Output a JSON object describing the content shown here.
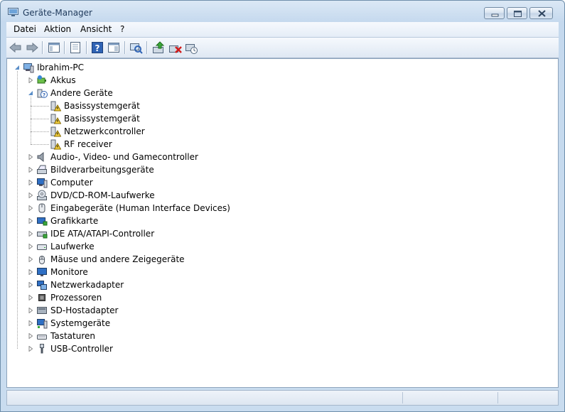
{
  "window": {
    "title": "Geräte-Manager"
  },
  "menu": [
    "Datei",
    "Aktion",
    "Ansicht",
    "?"
  ],
  "toolbar": [
    "back-arrow-icon",
    "forward-arrow-icon",
    "show-hide-console-tree-icon",
    "properties-icon",
    "help-icon",
    "console-tree-toggle-icon",
    "scan-hardware-icon",
    "update-driver-icon",
    "uninstall-device-icon",
    "disable-device-icon"
  ],
  "tree": {
    "root": "Ibrahim-PC",
    "categories": [
      {
        "label": "Akkus",
        "icon": "battery-icon",
        "expanded": false
      },
      {
        "label": "Andere Geräte",
        "icon": "unknown-device-icon",
        "expanded": true,
        "children": [
          {
            "label": "Basissystemgerät",
            "icon": "warning-device-icon"
          },
          {
            "label": "Basissystemgerät",
            "icon": "warning-device-icon"
          },
          {
            "label": "Netzwerkcontroller",
            "icon": "warning-device-icon"
          },
          {
            "label": "RF receiver",
            "icon": "warning-device-icon"
          }
        ]
      },
      {
        "label": "Audio-, Video- und Gamecontroller",
        "icon": "speaker-icon",
        "expanded": false
      },
      {
        "label": "Bildverarbeitungsgeräte",
        "icon": "scanner-icon",
        "expanded": false
      },
      {
        "label": "Computer",
        "icon": "computer-icon",
        "expanded": false
      },
      {
        "label": "DVD/CD-ROM-Laufwerke",
        "icon": "optical-drive-icon",
        "expanded": false
      },
      {
        "label": "Eingabegeräte (Human Interface Devices)",
        "icon": "hid-icon",
        "expanded": false
      },
      {
        "label": "Grafikkarte",
        "icon": "display-adapter-icon",
        "expanded": false
      },
      {
        "label": "IDE ATA/ATAPI-Controller",
        "icon": "ide-controller-icon",
        "expanded": false
      },
      {
        "label": "Laufwerke",
        "icon": "disk-drive-icon",
        "expanded": false
      },
      {
        "label": "Mäuse und andere Zeigegeräte",
        "icon": "mouse-icon",
        "expanded": false
      },
      {
        "label": "Monitore",
        "icon": "monitor-icon",
        "expanded": false
      },
      {
        "label": "Netzwerkadapter",
        "icon": "network-adapter-icon",
        "expanded": false
      },
      {
        "label": "Prozessoren",
        "icon": "processor-icon",
        "expanded": false
      },
      {
        "label": "SD-Hostadapter",
        "icon": "sd-host-icon",
        "expanded": false
      },
      {
        "label": "Systemgeräte",
        "icon": "system-device-icon",
        "expanded": false
      },
      {
        "label": "Tastaturen",
        "icon": "keyboard-icon",
        "expanded": false
      },
      {
        "label": "USB-Controller",
        "icon": "usb-icon",
        "expanded": false
      }
    ]
  },
  "status": {
    "panes": [
      "",
      "",
      ""
    ]
  }
}
